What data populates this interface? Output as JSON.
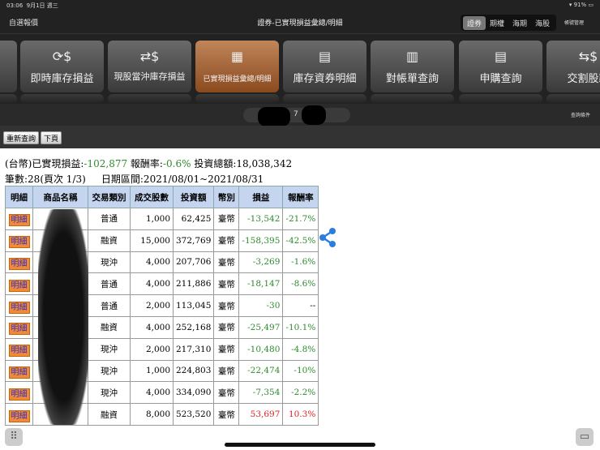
{
  "status": {
    "time": "03:06",
    "date": "9月1日 週三",
    "battery": "91%"
  },
  "titlebar": {
    "left": "自選報價",
    "title": "證券-已實現損益彙總/明細",
    "segments": [
      "證券",
      "期權",
      "海期",
      "海股"
    ],
    "active_segment": 0,
    "account": "帳號管理"
  },
  "toolbar": [
    {
      "icon": "dollar-refresh-search-icon",
      "label": "即時庫存損益"
    },
    {
      "icon": "daytrade-search-icon",
      "label": "現股當沖庫存損益"
    },
    {
      "icon": "grid-search-icon",
      "label": "已實現損益彙總/明細",
      "active": true
    },
    {
      "icon": "doc-search-icon",
      "label": "庫存資券明細"
    },
    {
      "icon": "book-icon",
      "label": "對帳單查詢"
    },
    {
      "icon": "doc-search-icon",
      "label": "申購查詢"
    },
    {
      "icon": "dollar-exchange-icon",
      "label": "交割股款"
    }
  ],
  "account_pill": "7",
  "query_conditions": "查詢條件",
  "buttons": {
    "requery": "重新查詢",
    "next_page": "下頁"
  },
  "summary": {
    "prefix": "(台幣)已實現損益:",
    "pnl": "-102,877",
    "rate_label": " 報酬率:",
    "rate": "-0.6%",
    "total_label": " 投資總額:",
    "total": "18,038,342"
  },
  "summary2": {
    "count": "筆數:28(頁次 1/3)",
    "range": "日期區間:2021/08/01~2021/08/31"
  },
  "table": {
    "headers": [
      "明細",
      "商品名稱",
      "交易類別",
      "成交股數",
      "投資額",
      "幣別",
      "損益",
      "報酬率"
    ],
    "detail_label": "明細",
    "rows": [
      {
        "type": "普通",
        "qty": "1,000",
        "amount": "62,425",
        "cur": "臺幣",
        "pnl": "-13,542",
        "rate": "-21.7%"
      },
      {
        "type": "融資",
        "qty": "15,000",
        "amount": "372,769",
        "cur": "臺幣",
        "pnl": "-158,395",
        "rate": "-42.5%"
      },
      {
        "type": "現沖",
        "qty": "4,000",
        "amount": "207,706",
        "cur": "臺幣",
        "pnl": "-3,269",
        "rate": "-1.6%"
      },
      {
        "type": "普通",
        "qty": "4,000",
        "amount": "211,886",
        "cur": "臺幣",
        "pnl": "-18,147",
        "rate": "-8.6%"
      },
      {
        "type": "普通",
        "qty": "2,000",
        "amount": "113,045",
        "cur": "臺幣",
        "pnl": "-30",
        "rate": "--"
      },
      {
        "type": "融資",
        "qty": "4,000",
        "amount": "252,168",
        "cur": "臺幣",
        "pnl": "-25,497",
        "rate": "-10.1%"
      },
      {
        "type": "現沖",
        "qty": "2,000",
        "amount": "217,310",
        "cur": "臺幣",
        "pnl": "-10,480",
        "rate": "-4.8%"
      },
      {
        "type": "現沖",
        "qty": "1,000",
        "amount": "224,803",
        "cur": "臺幣",
        "pnl": "-22,474",
        "rate": "-10%"
      },
      {
        "type": "現沖",
        "qty": "4,000",
        "amount": "334,090",
        "cur": "臺幣",
        "pnl": "-7,354",
        "rate": "-2.2%"
      },
      {
        "type": "融資",
        "qty": "8,000",
        "amount": "523,520",
        "cur": "臺幣",
        "pnl": "53,697",
        "rate": "10.3%"
      }
    ]
  },
  "colors": {
    "loss": "#2e8b2e",
    "gain": "#e02020",
    "active_tab": "#b06a35",
    "header_bg": "#c5d5f0",
    "share": "#2a7de1"
  }
}
